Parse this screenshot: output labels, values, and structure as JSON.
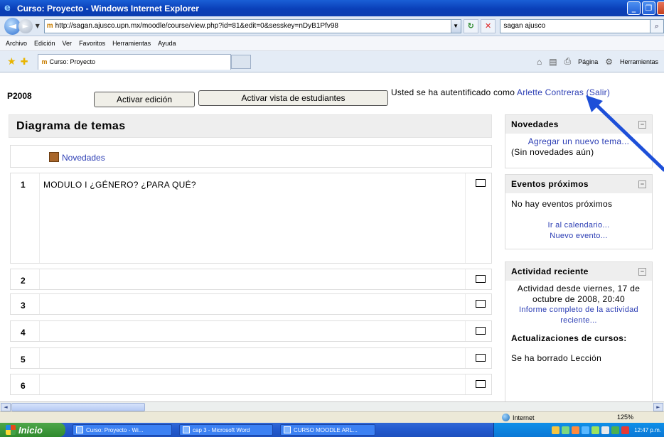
{
  "window": {
    "title": "Curso: Proyecto - Windows Internet Explorer",
    "minimize_glyph": "_",
    "maximize_glyph": "❐"
  },
  "address": {
    "url": "http://sagan.ajusco.upn.mx/moodle/course/view.php?id=81&edit=0&sesskey=nDyB1Pfv98",
    "search_value": "sagan ajusco",
    "favicon_text": "m"
  },
  "menu": [
    "Archivo",
    "Edición",
    "Ver",
    "Favoritos",
    "Herramientas",
    "Ayuda"
  ],
  "tab": {
    "label": "Curso: Proyecto"
  },
  "commandbar": {
    "page_label": "Página",
    "tools_label": "Herramientas"
  },
  "course": {
    "id": "P2008",
    "edit_button": "Activar edición",
    "student_view_button": "Activar vista de estudiantes",
    "login_prefix": "Usted se ha autentificado como ",
    "user_name": "Arlette Contreras",
    "logout": "(Salir)",
    "main_title": "Diagrama de temas",
    "news_forum": "Novedades",
    "sections": [
      {
        "num": "1",
        "title": "MODULO I ¿GÉNERO? ¿PARA QUÉ?"
      },
      {
        "num": "2",
        "title": ""
      },
      {
        "num": "3",
        "title": ""
      },
      {
        "num": "4",
        "title": ""
      },
      {
        "num": "5",
        "title": ""
      },
      {
        "num": "6",
        "title": ""
      }
    ]
  },
  "blocks": {
    "news": {
      "title": "Novedades",
      "add_link": "Agregar un nuevo tema...",
      "empty": "(Sin novedades aún)"
    },
    "events": {
      "title": "Eventos próximos",
      "empty": "No hay eventos próximos",
      "calendar_link": "Ir al calendario...",
      "new_event_link": "Nuevo evento..."
    },
    "recent": {
      "title": "Actividad reciente",
      "since": "Actividad desde viernes, 17 de octubre de 2008, 20:40",
      "full_report_link": "Informe completo de la actividad reciente...",
      "updates_title": "Actualizaciones de cursos:",
      "deleted_item": "Se ha borrado Lección"
    }
  },
  "status": {
    "zone": "Internet",
    "zoom": "125%"
  },
  "taskbar": {
    "start": "Inicio",
    "items": [
      "Curso: Proyecto - Wi...",
      "cap 3 - Microsoft Word",
      "CURSO MOODLE ARL..."
    ],
    "clock": "12:47 p.m."
  },
  "colors": {
    "link": "#2b3db4",
    "arrow": "#1d4fd8",
    "title_bar": "#0a3fb8"
  }
}
